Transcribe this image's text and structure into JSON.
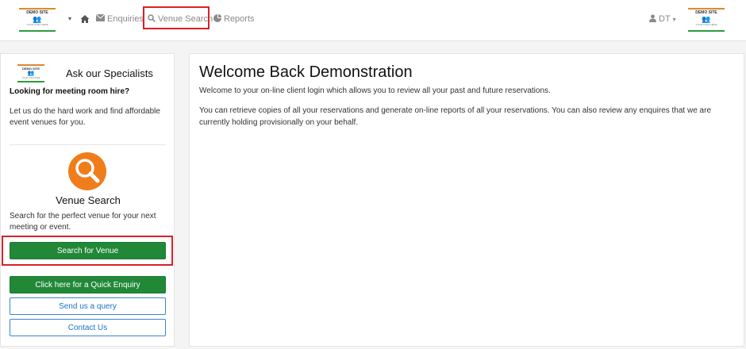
{
  "navbar": {
    "logo_title": "DEMO SITE",
    "logo_people": "👥",
    "logo_sub": "YOUR LOGO HERE",
    "caret": "▾",
    "enquiries_label": "Enquiries",
    "venue_search_label": "Venue Search",
    "reports_label": "Reports",
    "user_initials": "DT",
    "user_caret": "▾"
  },
  "sidebar": {
    "logo_title": "DEMO SITE",
    "logo_people": "👥",
    "logo_sub": "YOUR LOGO HERE",
    "ask_title": "Ask our Specialists",
    "looking_heading": "Looking for meeting room hire?",
    "intro_text": "Let us do the hard work and find affordable event venues for you.",
    "venue_search_title": "Venue Search",
    "venue_search_desc": "Search for the perfect venue for your next meeting or event.",
    "search_button_label": "Search for Venue",
    "quick_enquiry_label": "Click here for a Quick Enquiry",
    "send_query_label": "Send us a query",
    "contact_label": "Contact Us"
  },
  "main": {
    "title": "Welcome Back Demonstration",
    "welcome_text": "Welcome to your on-line client login which allows you to review all your past and future reservations.",
    "retrieve_text": "You can retrieve copies of all your reservations and generate on-line reports of all your reservations. You can also review any enquires that we are currently holding provisionally on your behalf."
  },
  "colors": {
    "accent_green": "#218838",
    "accent_orange": "#f07d1c",
    "outline_blue": "#1a73c8",
    "highlight_red": "#d9202a"
  },
  "icons": {
    "home": "home-icon",
    "enquiries": "envelope-icon",
    "venue_search": "search-icon",
    "reports": "pie-chart-icon",
    "user": "user-icon",
    "sidebar_search": "magnifier-icon"
  }
}
